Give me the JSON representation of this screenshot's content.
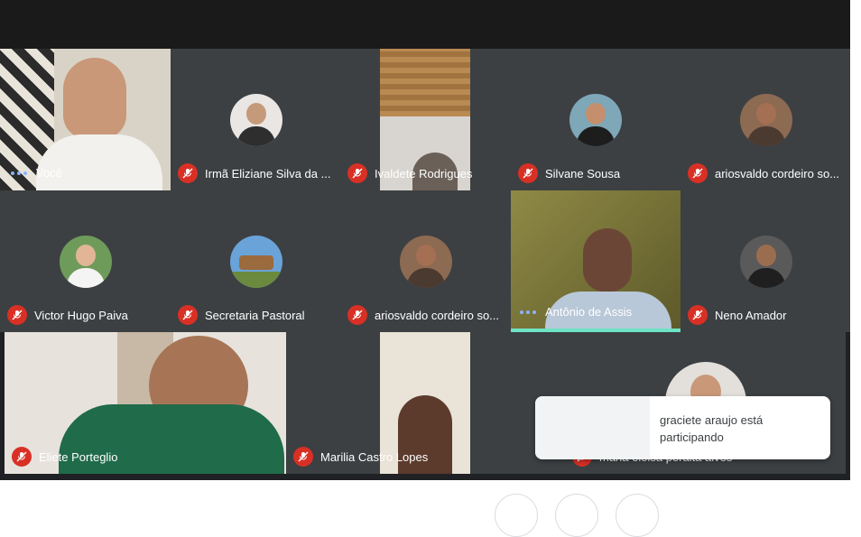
{
  "participants": [
    {
      "name": "Você"
    },
    {
      "name": "Irmã Eliziane Silva da ..."
    },
    {
      "name": "Ivaldete Rodrigues"
    },
    {
      "name": "Silvane Sousa"
    },
    {
      "name": "ariosvaldo cordeiro so..."
    },
    {
      "name": "Victor Hugo Paiva"
    },
    {
      "name": "Secretaria Pastoral"
    },
    {
      "name": "ariosvaldo cordeiro so..."
    },
    {
      "name": "Antônio de Assis"
    },
    {
      "name": "Neno Amador"
    },
    {
      "name": "Eliete Porteglio"
    },
    {
      "name": "Marilia Castro Lopes"
    },
    {
      "name": "maria eloisa peralta alves"
    }
  ],
  "toast": {
    "message": "graciete araujo está participando"
  },
  "colors": {
    "background": "#202124",
    "mic_muted": "#d93025",
    "speaking": "#6fe3c5",
    "dots": "#8ab4f8"
  }
}
